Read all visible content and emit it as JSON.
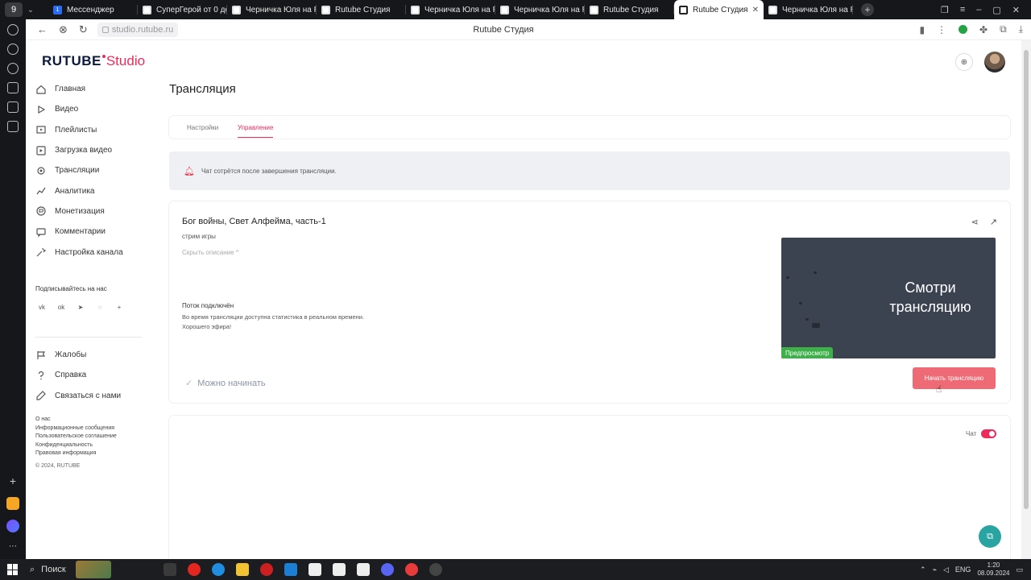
{
  "browser": {
    "tab_badge": "9",
    "tabs": [
      {
        "title": "Мессенджер",
        "icon": "messenger-icon",
        "active": false
      },
      {
        "title": "СуперГерой от 0 до",
        "icon": "rutube-icon",
        "active": false
      },
      {
        "title": "Черничка Юля на R",
        "icon": "rutube-icon",
        "active": false
      },
      {
        "title": "Rutube Студия",
        "icon": "rutube-icon",
        "active": false
      },
      {
        "title": "Черничка Юля на R",
        "icon": "rutube-icon",
        "active": false
      },
      {
        "title": "Черничка Юля на R",
        "icon": "rutube-icon",
        "active": false
      },
      {
        "title": "Rutube Студия",
        "icon": "rutube-icon",
        "active": false
      },
      {
        "title": "Rutube Студия",
        "icon": "rutube-icon",
        "active": true
      },
      {
        "title": "Черничка Юля на R",
        "icon": "rutube-icon",
        "active": false
      }
    ],
    "url": "studio.rutube.ru",
    "page_title": "Rutube Студия"
  },
  "app": {
    "logo_main": "RUTUBE",
    "logo_sub": "Studio",
    "brand_color": "#ed2b5b"
  },
  "sidebar": {
    "items": [
      {
        "label": "Главная",
        "icon": "home-icon"
      },
      {
        "label": "Видео",
        "icon": "video-icon"
      },
      {
        "label": "Плейлисты",
        "icon": "playlist-icon"
      },
      {
        "label": "Загрузка видео",
        "icon": "upload-icon"
      },
      {
        "label": "Трансляции",
        "icon": "broadcast-icon"
      },
      {
        "label": "Аналитика",
        "icon": "analytics-icon"
      },
      {
        "label": "Монетизация",
        "icon": "monetization-icon"
      },
      {
        "label": "Комментарии",
        "icon": "comments-icon"
      },
      {
        "label": "Настройка канала",
        "icon": "settings-icon"
      }
    ],
    "follow_title": "Подписывайтесь на нас",
    "socials": [
      "vk-icon",
      "ok-icon",
      "telegram-icon",
      "viber-icon",
      "more-icon"
    ],
    "secondary_items": [
      {
        "label": "Жалобы",
        "icon": "flag-icon"
      },
      {
        "label": "Справка",
        "icon": "help-icon"
      },
      {
        "label": "Связаться с нами",
        "icon": "contact-icon"
      }
    ],
    "footer_links": [
      "О нас",
      "Информационные сообщения",
      "Пользовательское соглашение",
      "Конфиденциальность",
      "Правовая информация"
    ],
    "copyright": "© 2024, RUTUBE"
  },
  "main": {
    "title": "Трансляция",
    "tabs": [
      {
        "label": "Настройки",
        "active": false
      },
      {
        "label": "Управление",
        "active": true
      }
    ],
    "notice": "Чат сотрётся после завершения трансляции.",
    "stream": {
      "title": "Бог войны, Свет Алфейма, часть-1",
      "subtitle": "стрим игры",
      "hide_description": "Скрыть описание ^",
      "status_title": "Поток подключён",
      "status_line1": "Во время трансляции доступна статистика в реальном времени.",
      "status_line2": "Хорошего эфира!",
      "ready_text": "Можно начинать",
      "preview_text": "Смотри трансляцию",
      "preview_badge": "Предпросмотр",
      "start_button": "Начать трансляцию"
    },
    "chat": {
      "label": "Чат",
      "enabled": true
    }
  },
  "taskbar": {
    "search": "Поиск",
    "lang": "ENG",
    "time": "1:20",
    "date": "08.09.2024"
  }
}
